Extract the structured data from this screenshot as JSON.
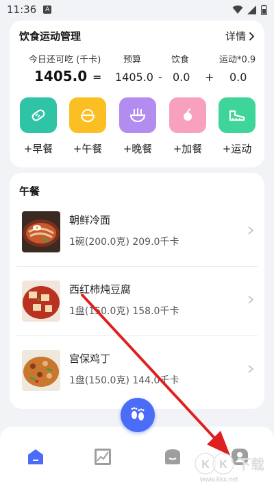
{
  "status_bar": {
    "time": "11:36",
    "notif_icon": "a-notification-icon"
  },
  "summary": {
    "title": "饮食运动管理",
    "detail_label": "详情",
    "labels": {
      "remaining": "今日还可吃 (千卡)",
      "budget": "预算",
      "food": "饮食",
      "exercise": "运动*0.9"
    },
    "values": {
      "remaining": "1405.0",
      "eq": "=",
      "budget": "1405.0",
      "minus": "-",
      "food": "0.0",
      "plus": "+",
      "exercise": "0.0"
    },
    "actions": [
      {
        "label": "+早餐",
        "icon": "breakfast-bread-icon",
        "color": "#2ec4a5"
      },
      {
        "label": "+午餐",
        "icon": "lunch-bowl-icon",
        "color": "#fbbf24"
      },
      {
        "label": "+晚餐",
        "icon": "dinner-noodle-icon",
        "color": "#b38cf0"
      },
      {
        "label": "+加餐",
        "icon": "snack-fruit-icon",
        "color": "#f7a1bf"
      },
      {
        "label": "+运动",
        "icon": "exercise-shoe-icon",
        "color": "#3ed49a"
      }
    ]
  },
  "meals": {
    "title": "午餐",
    "items": [
      {
        "name": "朝鲜冷面",
        "info": "1碗(200.0克) 209.0千卡"
      },
      {
        "name": "西红柿炖豆腐",
        "info": "1盘(150.0克) 158.0千卡"
      },
      {
        "name": "宫保鸡丁",
        "info": "1盘(150.0克) 144.0千卡"
      }
    ]
  },
  "bottom_nav": [
    {
      "icon": "home-icon",
      "active": true
    },
    {
      "icon": "chart-icon",
      "active": false
    },
    {
      "icon": "chef-hat-icon",
      "active": false
    },
    {
      "icon": "profile-icon",
      "active": false
    }
  ],
  "watermark": {
    "text": "KK下载",
    "url": "www.kkx.net"
  },
  "colors": {
    "accent": "#4a6cf7",
    "arrow": "#e02020"
  }
}
